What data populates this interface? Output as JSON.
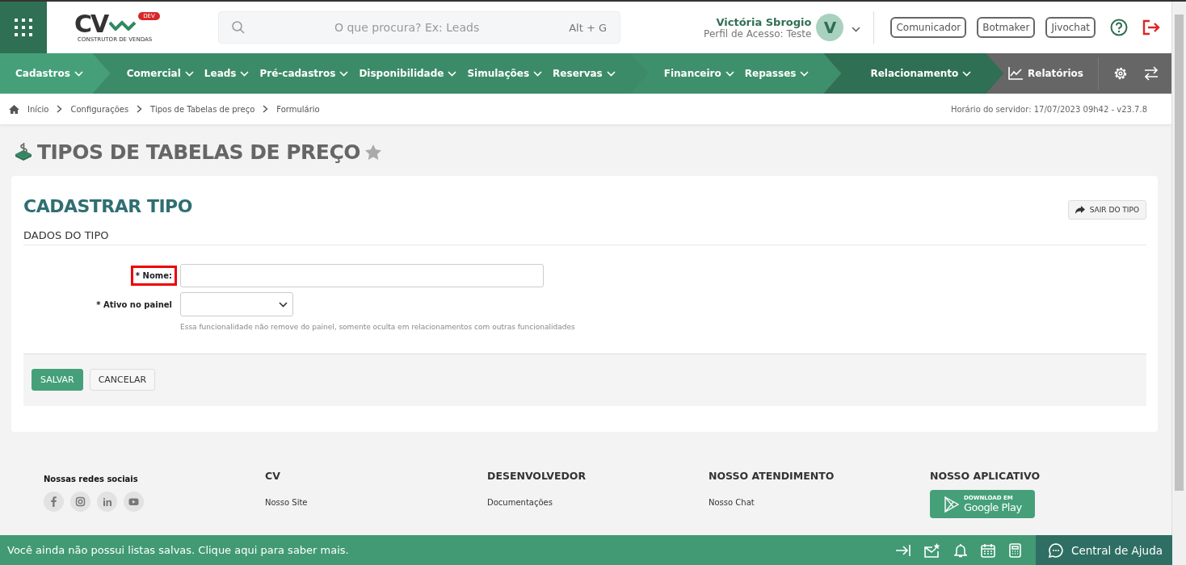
{
  "header": {
    "logo": {
      "mark": "CV",
      "badge": "DEV",
      "tagline": "CONSTRUTOR DE VENDAS"
    },
    "search": {
      "placeholder": "O que procura? Ex: Leads",
      "shortcut": "Alt + G"
    },
    "user": {
      "name": "Victória Sbrogio",
      "profile": "Perfil de Acesso: Teste",
      "initial": "V"
    },
    "buttons": [
      "Comunicador",
      "Botmaker",
      "Jivochat"
    ]
  },
  "nav": {
    "groups": [
      {
        "color": "#45a07a",
        "items": [
          "Cadastros"
        ]
      },
      {
        "color": "#3c8b68",
        "items": [
          "Comercial",
          "Leads",
          "Pré-cadastros",
          "Disponibilidade",
          "Simulações",
          "Reservas"
        ]
      },
      {
        "color": "#3e8f6b",
        "items": [
          "Financeiro",
          "Repasses"
        ]
      },
      {
        "color": "#2f6f53",
        "items": [
          "Relacionamento"
        ]
      }
    ],
    "reports": "Relatórios"
  },
  "breadcrumb": {
    "items": [
      "Início",
      "Configurações",
      "Tipos de Tabelas de preço",
      "Formulário"
    ],
    "server_time": "Horário do servidor: 17/07/2023 09h42 - v23.7.8"
  },
  "page_title": "TIPOS DE TABELAS DE PREÇO",
  "favorite": false,
  "form": {
    "title": "CADASTRAR TIPO",
    "exit_button": "SAIR DO TIPO",
    "section": "DADOS DO TIPO",
    "fields": [
      {
        "kind": "text",
        "label": "* Nome:",
        "highlighted": true
      },
      {
        "kind": "select",
        "label": "* Ativo no painel",
        "highlighted": false,
        "help": "Essa funcionalidade não remove do painel, somente oculta em relacionamentos com outras funcionalidades"
      }
    ],
    "actions": [
      {
        "kind": "primary",
        "label": "SALVAR"
      },
      {
        "kind": "secondary",
        "label": "CANCELAR"
      }
    ]
  },
  "footer": {
    "social_title": "Nossas redes sociais",
    "columns": [
      {
        "title": "CV",
        "links": [
          "Nosso Site"
        ]
      },
      {
        "title": "DESENVOLVEDOR",
        "links": [
          "Documentações"
        ]
      },
      {
        "title": "NOSSO ATENDIMENTO",
        "links": [
          "Nosso Chat"
        ]
      }
    ],
    "app": {
      "title": "NOSSO APLICATIVO",
      "badge_small": "DOWNLOAD EM",
      "badge_large": "Google Play"
    }
  },
  "bottom_bar": {
    "message": "Você ainda não possui listas salvas. Clique aqui para saber mais.",
    "help": "Central de Ajuda"
  }
}
